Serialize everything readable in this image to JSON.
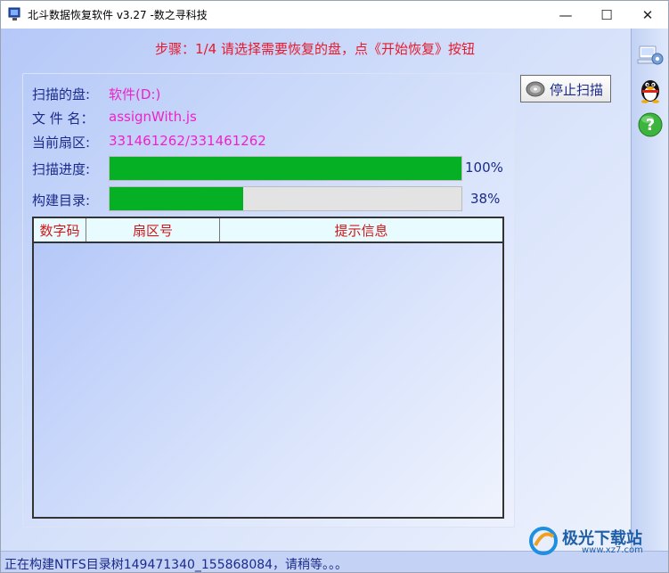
{
  "window": {
    "title": "北斗数据恢复软件 v3.27 -数之寻科技",
    "minimize_glyph": "—",
    "maximize_glyph": "☐",
    "close_glyph": "✕"
  },
  "step_text": "步骤：1/4 请选择需要恢复的盘，点《开始恢复》按钮",
  "info": {
    "disk_label": "扫描的盘:",
    "disk_value": "软件(D:)",
    "file_label": "文 件 名：",
    "file_value": "assignWith.js",
    "sector_label": "当前扇区:",
    "sector_value": "331461262/331461262"
  },
  "progress": {
    "scan_label": "扫描进度:",
    "scan_value": 100,
    "scan_text": "100%",
    "build_label": "构建目录:",
    "build_value": 38,
    "build_text": "38%"
  },
  "table": {
    "columns": [
      "数字码",
      "扇区号",
      "提示信息"
    ],
    "rows": []
  },
  "stop_button": {
    "label": "停止扫描",
    "icon": "disc-icon"
  },
  "sidebar": {
    "icons": [
      "settings-network-icon",
      "qq-penguin-icon",
      "help-question-icon"
    ]
  },
  "status_text": "正在构建NTFS目录树149471340_155868084，请稍等。。。",
  "watermark": {
    "text": "极光下载站",
    "url": "www.xz7.com"
  },
  "colors": {
    "step_red": "#e8192c",
    "label_blue": "#1b2a8c",
    "value_magenta": "#ee22cc",
    "progress_green": "#06b025",
    "header_red": "#d01818"
  }
}
